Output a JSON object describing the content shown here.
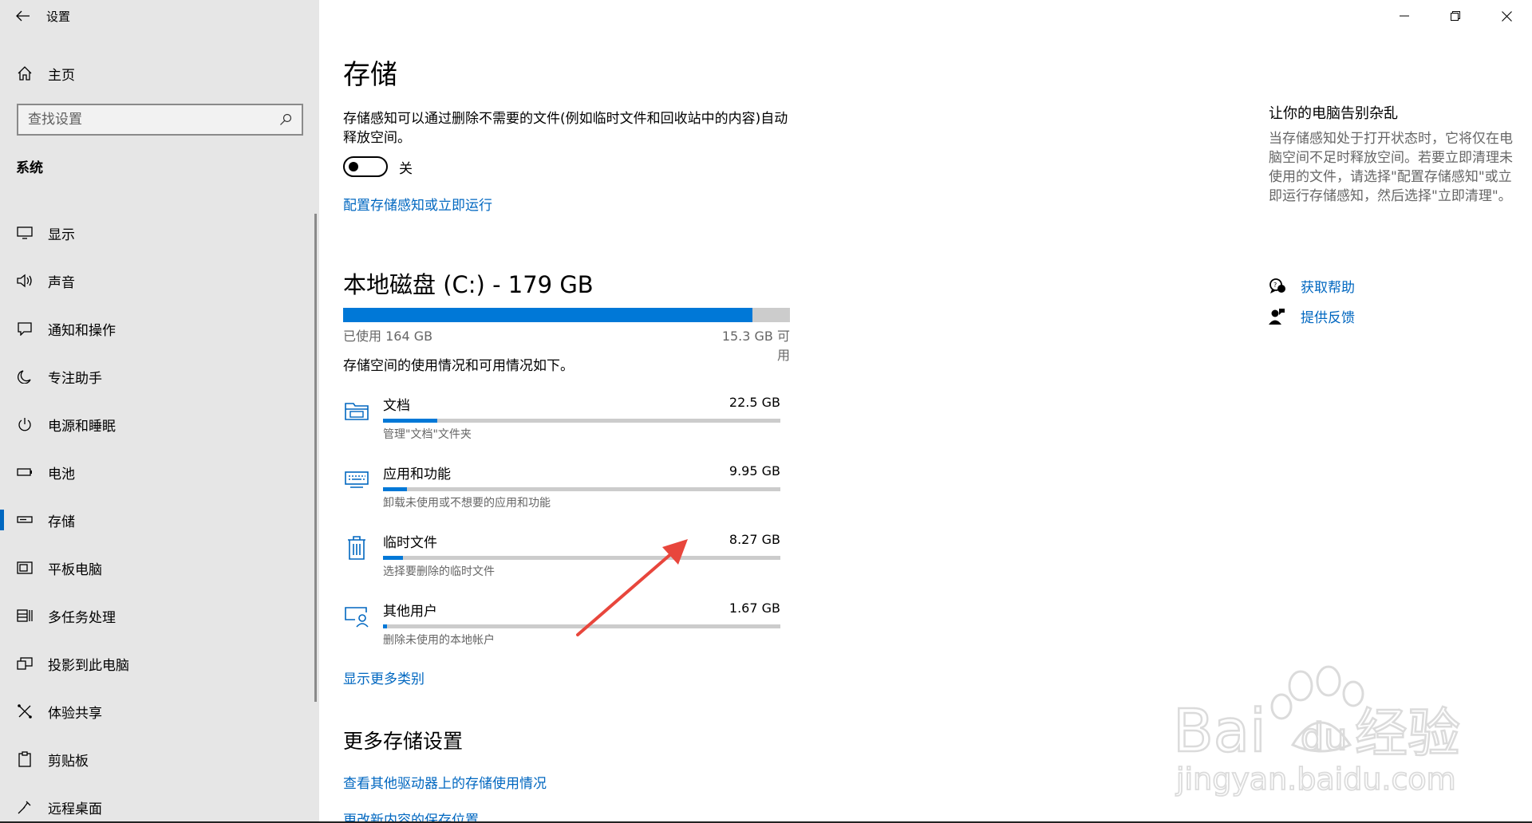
{
  "window": {
    "title": "设置",
    "controls": [
      "minimize",
      "restore",
      "close"
    ]
  },
  "sidebar": {
    "home_label": "主页",
    "search_placeholder": "查找设置",
    "section_label": "系统",
    "items": [
      {
        "label": "显示",
        "icon": "monitor-icon"
      },
      {
        "label": "声音",
        "icon": "speaker-icon"
      },
      {
        "label": "通知和操作",
        "icon": "notification-icon"
      },
      {
        "label": "专注助手",
        "icon": "moon-icon"
      },
      {
        "label": "电源和睡眠",
        "icon": "power-icon"
      },
      {
        "label": "电池",
        "icon": "battery-icon"
      },
      {
        "label": "存储",
        "icon": "storage-icon",
        "selected": true
      },
      {
        "label": "平板电脑",
        "icon": "tablet-icon"
      },
      {
        "label": "多任务处理",
        "icon": "multitask-icon"
      },
      {
        "label": "投影到此电脑",
        "icon": "project-icon"
      },
      {
        "label": "体验共享",
        "icon": "share-icon"
      },
      {
        "label": "剪贴板",
        "icon": "clipboard-icon"
      },
      {
        "label": "远程桌面",
        "icon": "remote-icon"
      }
    ]
  },
  "main": {
    "title": "存储",
    "description": "存储感知可以通过删除不需要的文件(例如临时文件和回收站中的内容)自动释放空间。",
    "toggle_label": "关",
    "toggle_on": false,
    "config_link": "配置存储感知或立即运行",
    "disk": {
      "title": "本地磁盘 (C:) - 179 GB",
      "used_label": "已使用 164 GB",
      "free_label": "15.3 GB 可用",
      "used_fraction": 0.916
    },
    "usage_description": "存储空间的使用情况和可用情况如下。",
    "categories": [
      {
        "name": "文档",
        "size": "22.5 GB",
        "sub": "管理\"文档\"文件夹",
        "fraction": 0.137,
        "icon": "folder-icon"
      },
      {
        "name": "应用和功能",
        "size": "9.95 GB",
        "sub": "卸载未使用或不想要的应用和功能",
        "fraction": 0.061,
        "icon": "keyboard-icon"
      },
      {
        "name": "临时文件",
        "size": "8.27 GB",
        "sub": "选择要删除的临时文件",
        "fraction": 0.05,
        "icon": "trash-icon"
      },
      {
        "name": "其他用户",
        "size": "1.67 GB",
        "sub": "删除未使用的本地帐户",
        "fraction": 0.01,
        "icon": "user-monitor-icon"
      }
    ],
    "more_categories_link": "显示更多类别",
    "more_settings_title": "更多存储设置",
    "more_links": [
      "查看其他驱动器上的存储使用情况",
      "更改新内容的保存位置"
    ]
  },
  "right_panel": {
    "title": "让你的电脑告别杂乱",
    "description": "当存储感知处于打开状态时，它将仅在电脑空间不足时释放空间。若要立即清理未使用的文件，请选择\"配置存储感知\"或立即运行存储感知，然后选择\"立即清理\"。",
    "help_link": "获取帮助",
    "feedback_link": "提供反馈"
  },
  "watermark": {
    "brand": "Bai",
    "brand_du": "du",
    "brand_cn": "经验",
    "url": "jingyan.baidu.com"
  },
  "colors": {
    "accent": "#0067c0",
    "bar_fill": "#0078d7",
    "bar_track": "#cccccc",
    "sidebar_bg": "#e6e6e6",
    "arrow": "#e8463c"
  }
}
